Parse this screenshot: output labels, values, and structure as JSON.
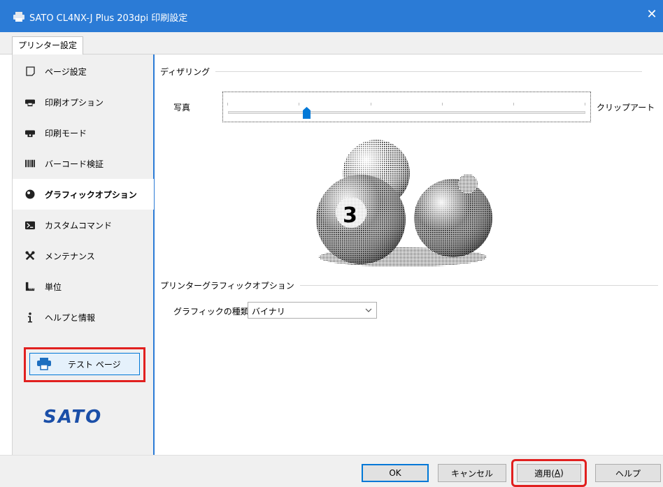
{
  "window": {
    "title": "SATO CL4NX-J Plus 203dpi 印刷設定",
    "close_glyph": "✕",
    "title_icon": "printer-icon"
  },
  "tabs": [
    {
      "label": "プリンター設定"
    }
  ],
  "sidebar": {
    "items": [
      {
        "label": "ページ設定",
        "icon": "page-icon",
        "selected": false
      },
      {
        "label": "印刷オプション",
        "icon": "printer-icon",
        "selected": false
      },
      {
        "label": "印刷モード",
        "icon": "printer-mode-icon",
        "selected": false
      },
      {
        "label": "バーコード検証",
        "icon": "barcode-icon",
        "selected": false
      },
      {
        "label": "グラフィックオプション",
        "icon": "ball-icon",
        "selected": true
      },
      {
        "label": "カスタムコマンド",
        "icon": "terminal-icon",
        "selected": false
      },
      {
        "label": "メンテナンス",
        "icon": "tools-icon",
        "selected": false
      },
      {
        "label": "単位",
        "icon": "ruler-icon",
        "selected": false
      },
      {
        "label": "ヘルプと情報",
        "icon": "info-icon",
        "selected": false
      }
    ],
    "test_page": {
      "label": "テスト ページ",
      "icon": "test-printer-icon"
    },
    "logo_text": "SATO"
  },
  "main": {
    "dithering": {
      "heading": "ディザリング",
      "left_label": "写真",
      "right_label": "クリップアート",
      "slider_value": 0.22
    },
    "printer_graphics": {
      "heading": "プリンターグラフィックオプション",
      "type_label": "グラフィックの種類:",
      "type_value": "バイナリ"
    }
  },
  "buttons": {
    "ok": "OK",
    "cancel": "キャンセル",
    "apply_text": "適用(",
    "apply_key": "A",
    "apply_close": ")",
    "help": "ヘルプ"
  },
  "colors": {
    "accent": "#2b7bd6",
    "highlight": "#e1201f",
    "logo": "#1b4fa8"
  }
}
